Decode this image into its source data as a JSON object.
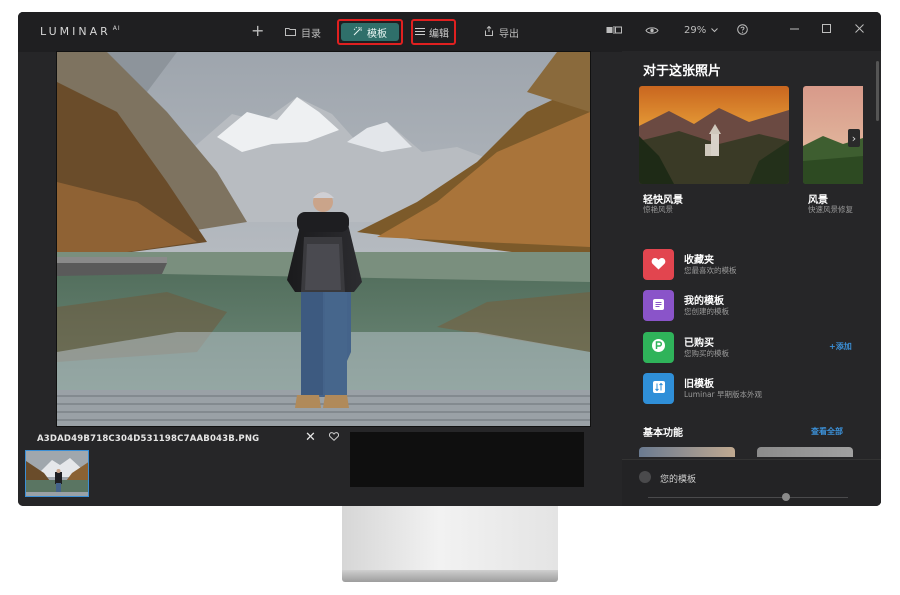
{
  "app": {
    "logo": "LUMINAR",
    "logo_sup": "AI"
  },
  "toolbar": {
    "add_label": "+",
    "catalog_label": "目录",
    "templates_label": "模板",
    "edit_label": "编辑",
    "export_label": "导出",
    "zoom": "29%"
  },
  "photo": {
    "filename": "A3DAD49B718C304D531198C7AAB043B.PNG"
  },
  "panel": {
    "title": "对于这张照片",
    "cards": [
      {
        "title": "轻快风景",
        "subtitle": "惊艳风景"
      },
      {
        "title": "风景",
        "subtitle": "快速风景修复"
      }
    ],
    "items": [
      {
        "title": "收藏夹",
        "subtitle": "您最喜欢的模板",
        "color": "#e2454f"
      },
      {
        "title": "我的模板",
        "subtitle": "您创建的模板",
        "color": "#8a54c9"
      },
      {
        "title": "已购买",
        "subtitle": "您购买的模板",
        "color": "#2fb35a"
      },
      {
        "title": "旧模板",
        "subtitle": "Luminar 早期版本外观",
        "color": "#2f8fd8"
      }
    ],
    "add_link": "+添加",
    "basic_title": "基本功能",
    "view_all": "查看全部",
    "your_templates": "您的模板"
  },
  "colors": {
    "accent": "#3b8fd6",
    "active_tab": "#2f6f6a",
    "highlight_box": "#e02020"
  }
}
